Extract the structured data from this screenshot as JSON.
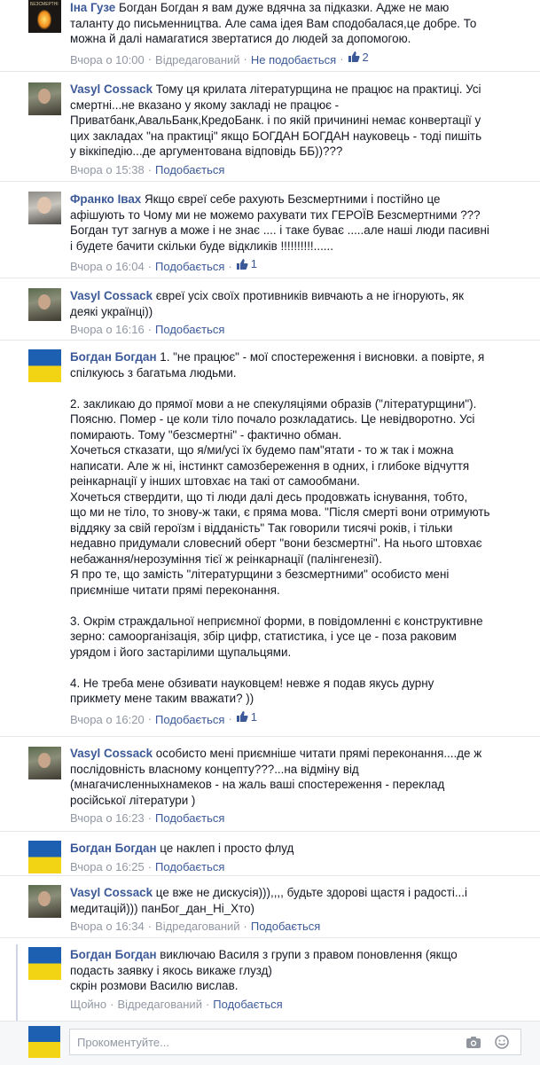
{
  "actions": {
    "like": "Подобається",
    "unlike": "Не подобається",
    "edited": "Відредагований"
  },
  "comments": [
    {
      "author": "Іна Гузе",
      "lines": [
        "Богдан Богдан я вам дуже вдячна за підказки. Адже не маю",
        "таланту до письменництва. Але сама ідея Вам сподобалася,це добре. То",
        "можна й далі намагатися звертатися до людей за допомогою."
      ],
      "time": "Вчора о 10:00",
      "like_count": "2"
    },
    {
      "author": "Vasyl Cossack",
      "lines": [
        "Тому ця крилата літературщина не працює на практиці. Усі",
        "смертні...не вказано у якому закладі не працює -",
        "Приватбанк,АвальБанк,КредоБанк. і по якій причинині немає конвертації у",
        "цих закладах \"на практиці\" якщо БОГДАН БОГДАН науковець - тоді пишіть",
        "у віккіпедію...де аргументована відповідь ББ))???"
      ],
      "time": "Вчора о 15:38"
    },
    {
      "author": "Франко Івах",
      "lines": [
        "Якщо євреї себе рахують Безсмертними і постійно це",
        "афішують то Чому ми не можемо рахувати тих ГЕРОЇВ Безсмертними ???",
        "Богдан тут загнув а може і не знає .... і таке буває .....але наші люди пасивні",
        "і будете бачити скільки буде відкликів !!!!!!!!!!......"
      ],
      "time": "Вчора о 16:04",
      "like_count": "1"
    },
    {
      "author": "Vasyl Cossack",
      "lines": [
        "євреї усіх своїх противників вивчають а не ігнорують, як",
        "деякі українці))"
      ],
      "time": "Вчора о 16:16"
    },
    {
      "author": "Богдан Богдан",
      "paragraphs": [
        [
          "1. \"не працює\" - мої спостереження і висновки. а повірте, я",
          "спілкуюсь з багатьма людьми."
        ],
        [
          "2. закликаю до прямої мови а не спекуляціями образів (\"літературщини\").",
          "Поясню. Помер - це коли тіло почало розкладатись. Це невідворотно. Усі",
          "помирають. Тому \"безсмертні\" - фактично обман.",
          "Хочеться стказати, що я/ми/усі їх будемо пам\"ятати - то ж так і можна",
          "написати. Але ж ні, інстинкт самозбереження в одних, і глибоке відчуття",
          "реінкарнації у інших штовхає на такі от самообмани.",
          "Хочеться ствердити, що ті люди далі десь продовжать існування, тобто,",
          "що ми не тіло, то знову-ж таки, є пряма мова. \"Після смерті вони отримують",
          "віддяку за свій героїзм і відданість\" Так говорили тисячі років, і тільки",
          "недавно придумали словесний оберт \"вони безсмертні\". На нього штовхає",
          "небажання/нерозуміння тієї ж реінкарнації (палінгенезії).",
          "Я про те, що замість \"літературщини з безсмертними\" особисто мені",
          "приємніше читати прямі переконання."
        ],
        [
          "3. Окрім страждальної неприємної форми, в повідомленні є конструктивне",
          "зерно: самоорганізація, збір цифр, статистика, і усе це - поза раковим",
          "урядом і його застарілими щупальцями."
        ],
        [
          "4. Не треба мене обзивати науковцем! невже я подав якусь дурну",
          "прикмету мене таким вважати? ))"
        ]
      ],
      "time": "Вчора о 16:20",
      "like_count": "1"
    },
    {
      "author": "Vasyl Cossack",
      "lines": [
        "особисто мені приємніше читати прямі переконання....де ж",
        "послідовність власному концепту???...на відміну від",
        "(мнагачисленныхнамеков - на жаль ваші спостереження - переклад",
        "російської літератури )"
      ],
      "time": "Вчора о 16:23"
    },
    {
      "author": "Богдан Богдан",
      "lines": [
        "це наклеп і просто флуд"
      ],
      "time": "Вчора о 16:25"
    },
    {
      "author": "Vasyl Cossack",
      "lines": [
        "це вже не дискусія))),,,, будьте здорові щастя і радості...і",
        "медитацій))) панБог_дан_Ні_Хто)"
      ],
      "time": "Вчора о 16:34"
    },
    {
      "author": "Богдан Богдан",
      "lines": [
        "виключаю Василя з групи з правом поновлення (якщо",
        "подасть заявку і якось викаже глузд)",
        "скрін розмови Василю вислав."
      ],
      "time": "Щойно"
    }
  ],
  "composer": {
    "placeholder": "Прокоментуйте..."
  }
}
